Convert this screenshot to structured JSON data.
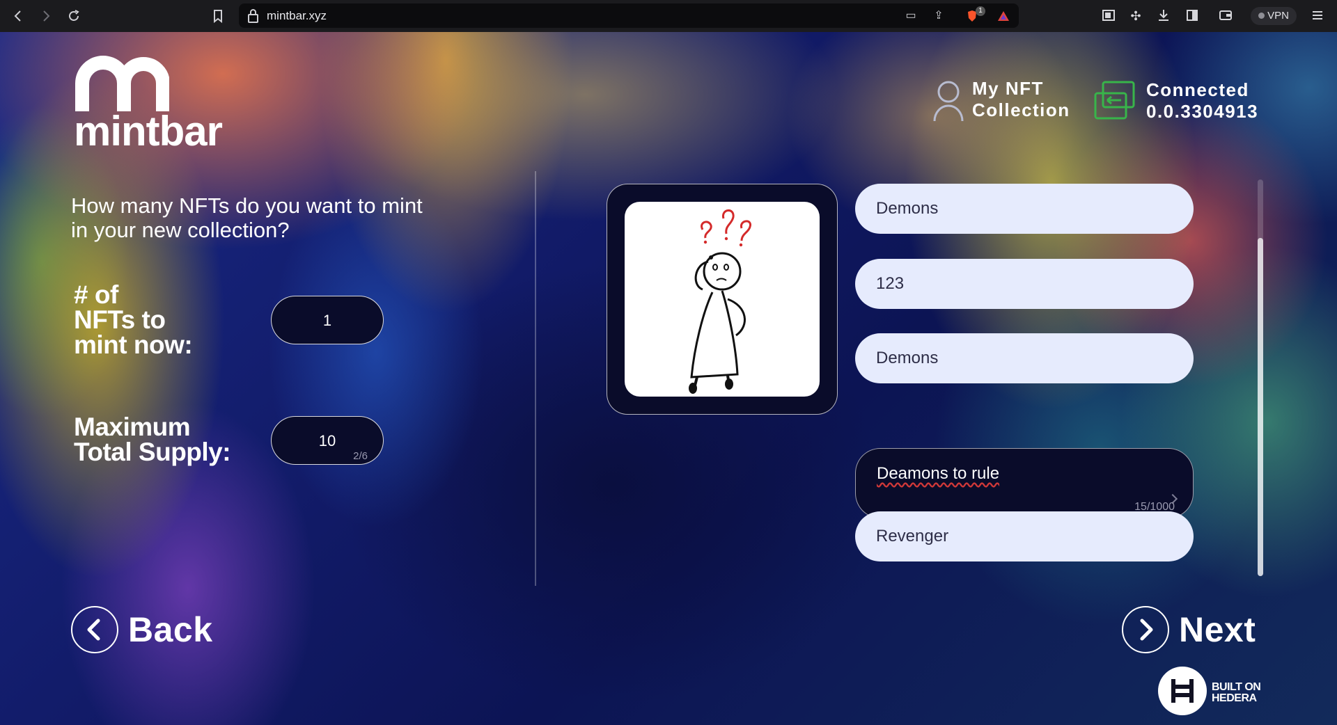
{
  "browser": {
    "url": "mintbar.xyz",
    "vpn_label": "VPN",
    "brave_badge": "1"
  },
  "brand": {
    "name": "mintbar"
  },
  "header": {
    "collection_link": [
      "My NFT",
      "Collection"
    ],
    "wallet_status": [
      "Connected",
      "0.0.3304913"
    ]
  },
  "form": {
    "question": "How many NFTs do you want to mint in your new collection?",
    "mint_now": {
      "label": [
        "# of",
        "NFTs to",
        "mint now:"
      ],
      "value": "1"
    },
    "max_supply": {
      "label": [
        "Maximum",
        "Total Supply:"
      ],
      "value": "10",
      "counter": "2/6"
    }
  },
  "details": {
    "image_alt": "stick figure with question marks",
    "fields": [
      {
        "value": "Demons"
      },
      {
        "value": "123"
      },
      {
        "value": "Demons"
      },
      {
        "value": "Deamons to rule",
        "counter": "15/1000"
      },
      {
        "value": "Revenger"
      }
    ]
  },
  "navigation": {
    "back_label": "Back",
    "next_label": "Next"
  },
  "footer": {
    "badge_lines": [
      "BUILT ON",
      "HEDERA"
    ]
  },
  "colors": {
    "accent_green": "#38b54a",
    "field_light": "#e6ebfd",
    "field_dark": "#0a0c2a"
  }
}
